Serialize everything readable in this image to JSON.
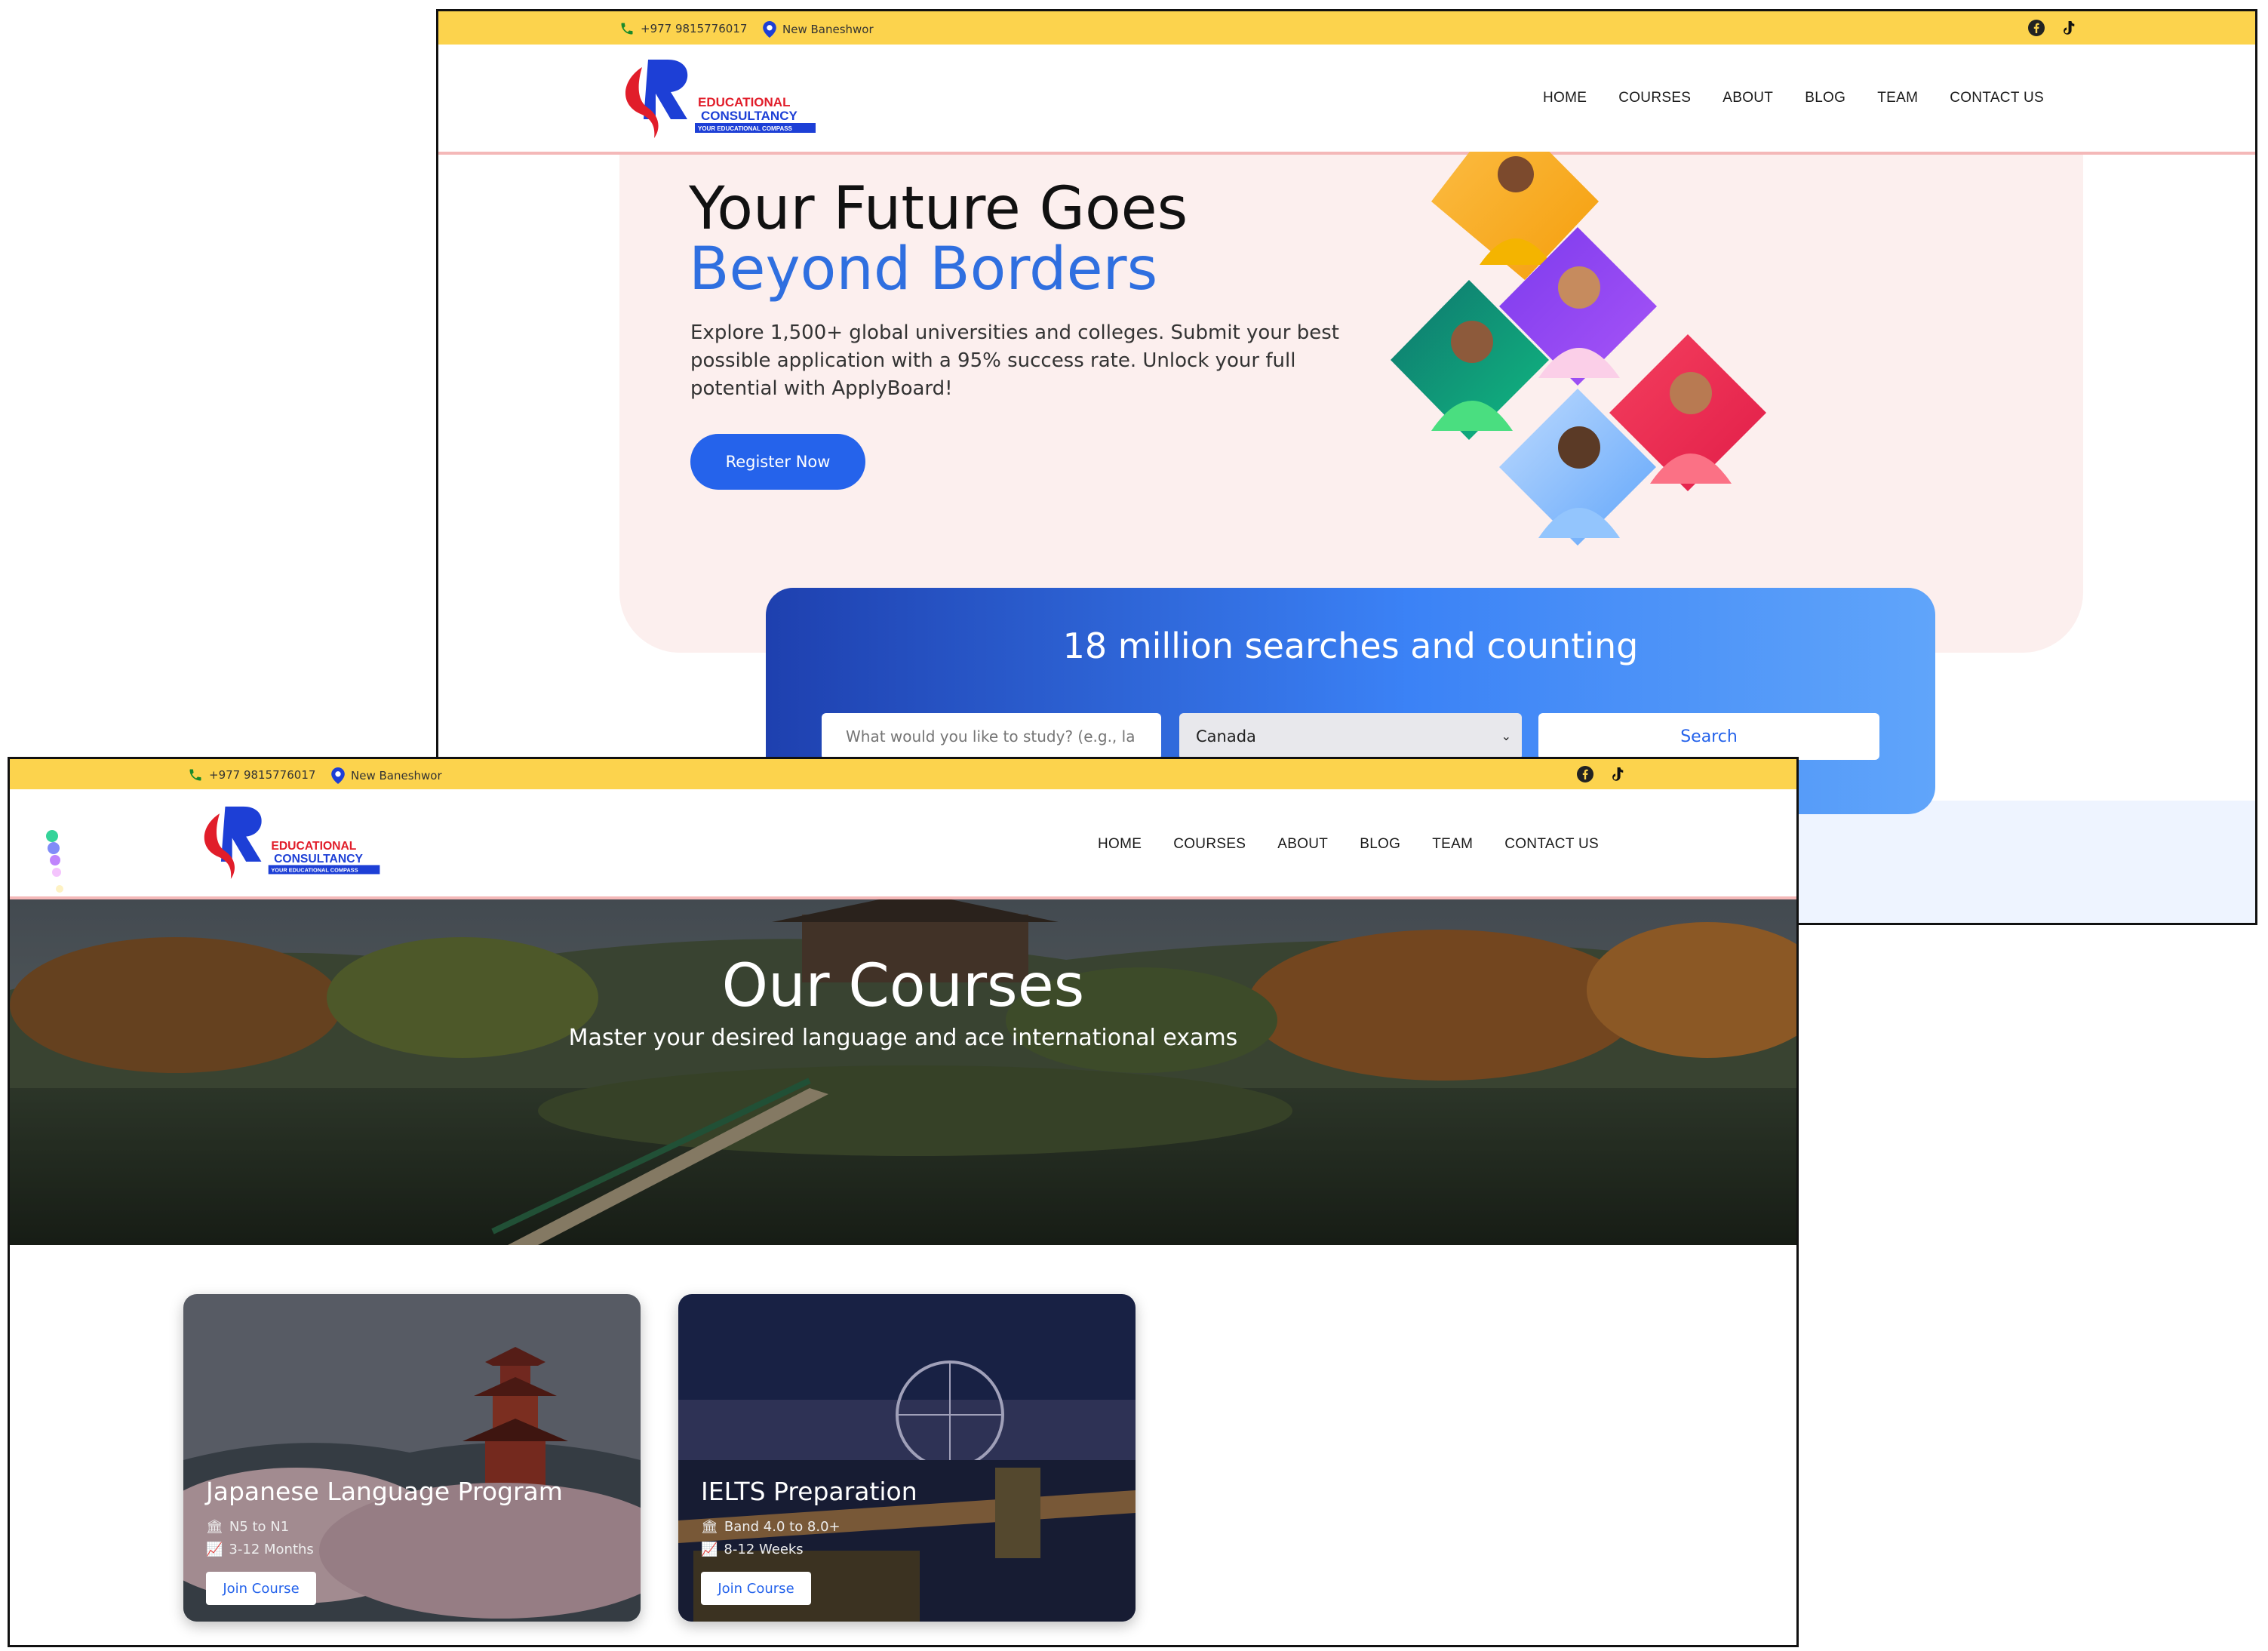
{
  "topbar": {
    "phone": "+977 9815776017",
    "location": "New Baneshwor",
    "social": [
      "facebook-icon",
      "tiktok-icon"
    ],
    "bg_color": "#fcd34d"
  },
  "logo": {
    "line1": "EDUCATIONAL",
    "line2": "CONSULTANCY",
    "tagline": "YOUR EDUCATIONAL COMPASS"
  },
  "nav": {
    "items": [
      "HOME",
      "COURSES",
      "ABOUT",
      "BLOG",
      "TEAM",
      "CONTACT US"
    ]
  },
  "hero": {
    "title_line1": "Your Future Goes",
    "title_line2": "Beyond Borders",
    "text": "Explore 1,500+ global universities and colleges. Submit your best possible application with a 95% success rate. Unlock your full potential with ApplyBoard!",
    "button": "Register Now",
    "accent": "#2f6fe0"
  },
  "search": {
    "title": "18 million searches and counting",
    "placeholder": "What would you like to study? (e.g., la",
    "country": "Canada",
    "button": "Search"
  },
  "courses_page": {
    "title": "Our Courses",
    "subtitle": "Master your desired language and ace international exams",
    "cards": [
      {
        "title": "Japanese Language Program",
        "meta1": "N5 to N1",
        "meta2": "3-12 Months",
        "button": "Join Course"
      },
      {
        "title": "IELTS Preparation",
        "meta1": "Band 4.0 to 8.0+",
        "meta2": "8-12 Weeks",
        "button": "Join Course"
      }
    ]
  }
}
